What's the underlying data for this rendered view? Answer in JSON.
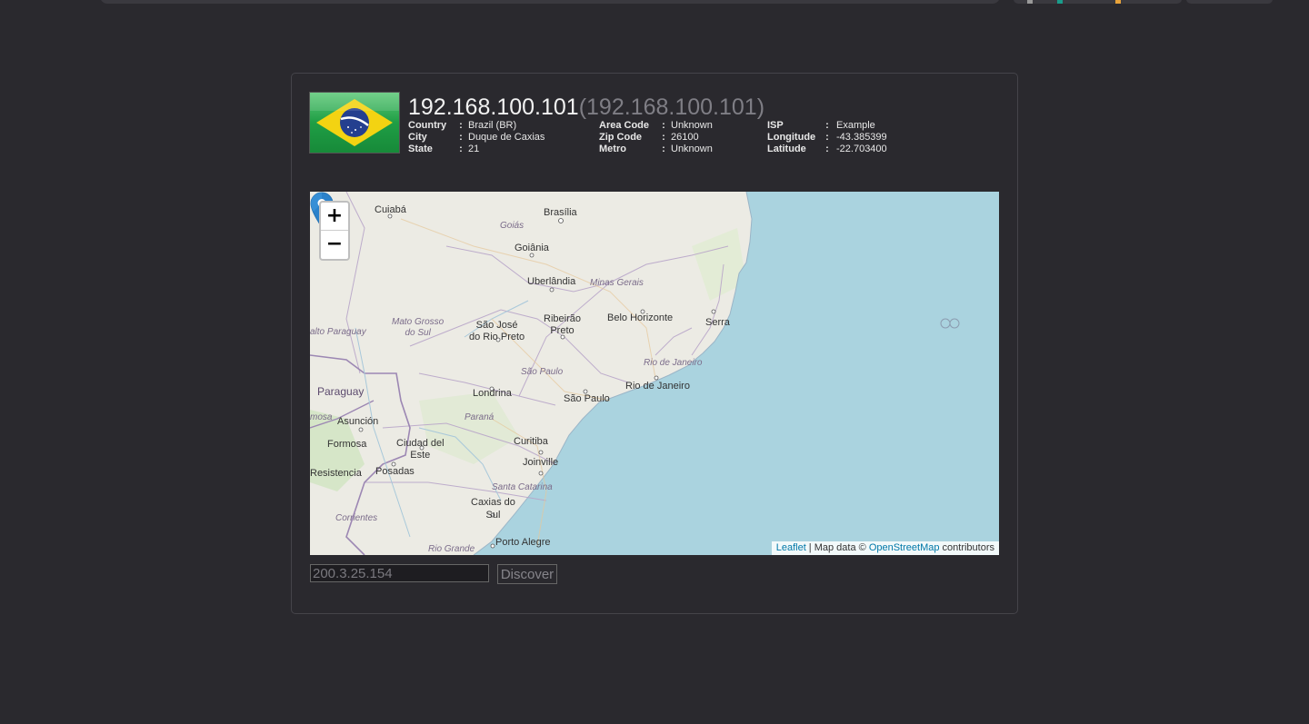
{
  "header": {
    "ip": "192.168.100.101",
    "ip_paren": "(192.168.100.101)"
  },
  "flag": {
    "country": "Brazil",
    "icon": "brazil-flag-icon",
    "colors": {
      "green": "#1fa042",
      "yellow": "#f5d30b",
      "blue": "#1f3f8c"
    }
  },
  "info": {
    "col1": [
      {
        "key": "Country",
        "sep": ":",
        "value": "Brazil (BR)"
      },
      {
        "key": "City",
        "sep": ":",
        "value": "Duque de Caxias"
      },
      {
        "key": "State",
        "sep": ":",
        "value": "21"
      }
    ],
    "col2": [
      {
        "key": "Area Code",
        "sep": ":",
        "value": "Unknown"
      },
      {
        "key": "Zip Code",
        "sep": ":",
        "value": "26100"
      },
      {
        "key": "Metro",
        "sep": ":",
        "value": "Unknown"
      }
    ],
    "col3": [
      {
        "key": "ISP",
        "sep": ":",
        "value": "Example"
      },
      {
        "key": "Longitude",
        "sep": ":",
        "value": "-43.385399"
      },
      {
        "key": "Latitude",
        "sep": ":",
        "value": "-22.703400"
      }
    ]
  },
  "map": {
    "zoom_in": "+",
    "zoom_out": "−",
    "marker_icon": "map-pin-icon",
    "attribution": {
      "leaflet": "Leaflet",
      "middle": " | Map data © ",
      "osm": "OpenStreetMap",
      "end": " contributors"
    },
    "labels": {
      "cuiaba": "Cuiabá",
      "brasilia": "Brasília",
      "goias": "Goiás",
      "goiania": "Goiânia",
      "uberlandia": "Uberlândia",
      "minas": "Minas Gerais",
      "ribeirao": "Ribeirão\nPreto",
      "belo": "Belo Horizonte",
      "serra": "Serra",
      "mato": "Mato Grosso\ndo Sul",
      "sjrp": "São José\ndo Rio Preto",
      "paraguay_river": "alto Paraguay",
      "sao_paulo_state": "São Paulo",
      "rio_state": "Rio de Janeiro",
      "rio_city": "Rio de Janeiro",
      "paraguay": "Paraguay",
      "londrina": "Londrina",
      "sao_paulo_city": "São Paulo",
      "parana": "Paraná",
      "asuncion": "Asunción",
      "formosa_prov": "mosa",
      "formosa": "Formosa",
      "ciudad": "Ciudad del\nEste",
      "curitiba": "Curitiba",
      "joinville": "Joinville",
      "resistencia": "Resistencia",
      "posadas": "Posadas",
      "santa_catarina": "Santa Catarina",
      "caxias": "Caxias do\nSul",
      "corrientes": "Corrientes",
      "rio_grande": "Rio Grande",
      "porto_alegre": "Porto Alegre"
    }
  },
  "form": {
    "placeholder": "200.3.25.154",
    "button": "Discover"
  }
}
